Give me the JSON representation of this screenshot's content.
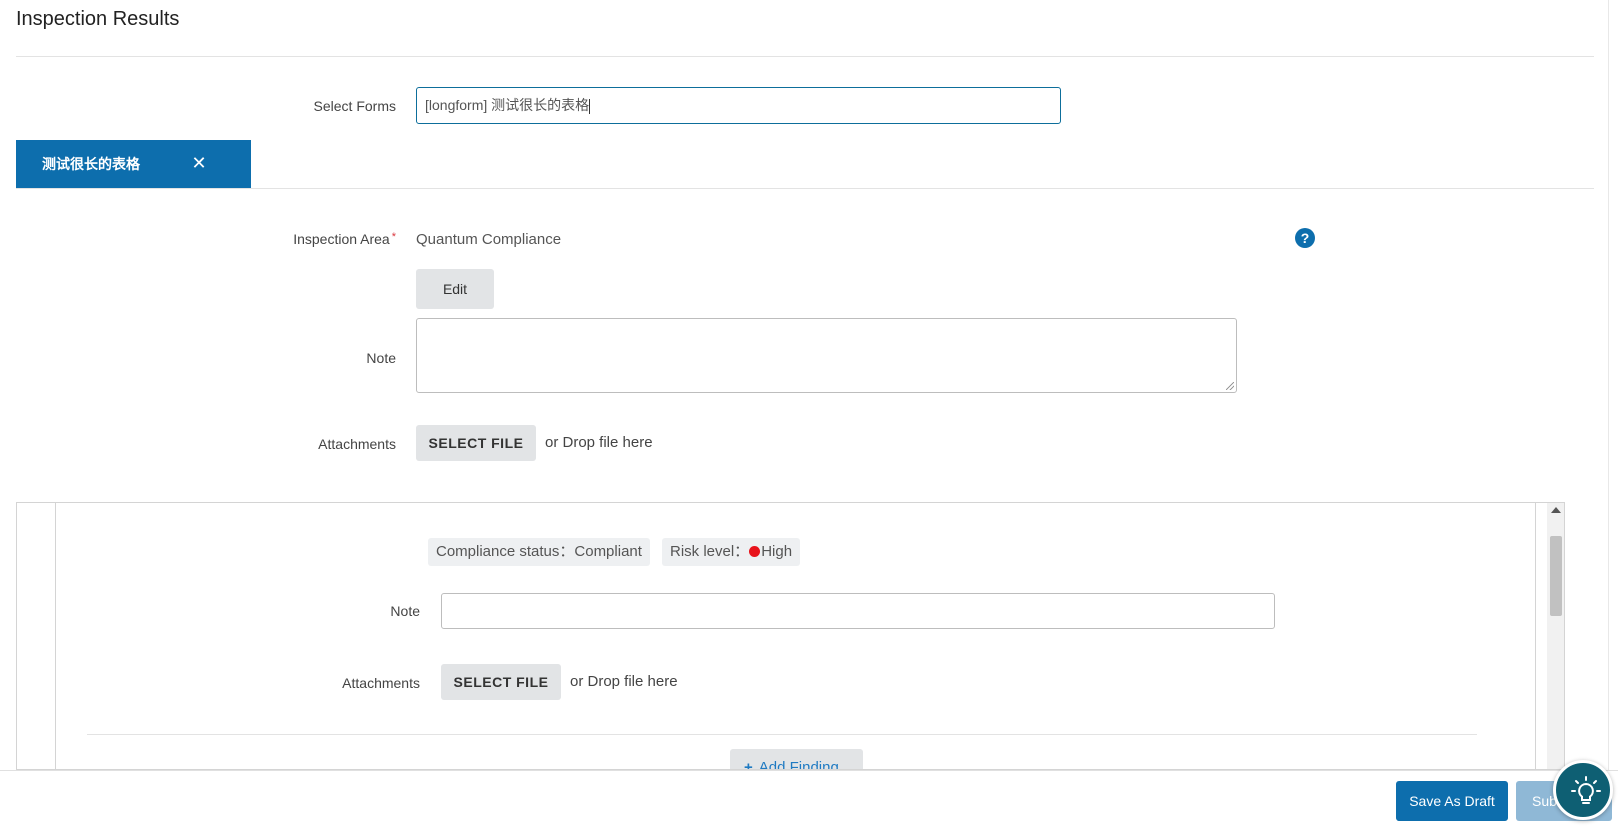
{
  "page": {
    "title": "Inspection Results"
  },
  "select_forms": {
    "label": "Select Forms",
    "value": "[longform] 测试很长的表格"
  },
  "form_tab": {
    "label": "测试很长的表格",
    "close_icon": "close-icon"
  },
  "inspection_area": {
    "label": "Inspection Area",
    "required_mark": "*",
    "value": "Quantum Compliance",
    "edit_label": "Edit",
    "help_icon": "question-circle-icon"
  },
  "note": {
    "label": "Note",
    "value": ""
  },
  "attachments": {
    "label": "Attachments",
    "select_file_label": "SELECT FILE",
    "drop_text": "or Drop file here"
  },
  "finding": {
    "compliance_status": "Compliance status：Compliant",
    "risk_level_prefix": "Risk level：",
    "risk_level_value": "High",
    "risk_color": "#e8131b",
    "note_label": "Note",
    "note_value": "",
    "attachments_label": "Attachments",
    "select_file_label": "SELECT FILE",
    "drop_text": "or Drop file here",
    "add_finding_label": "Add Finding"
  },
  "footer": {
    "save_draft_label": "Save As Draft",
    "submit_label": "Sub"
  },
  "colors": {
    "primary": "#0d6ead",
    "required": "#d9363e"
  }
}
